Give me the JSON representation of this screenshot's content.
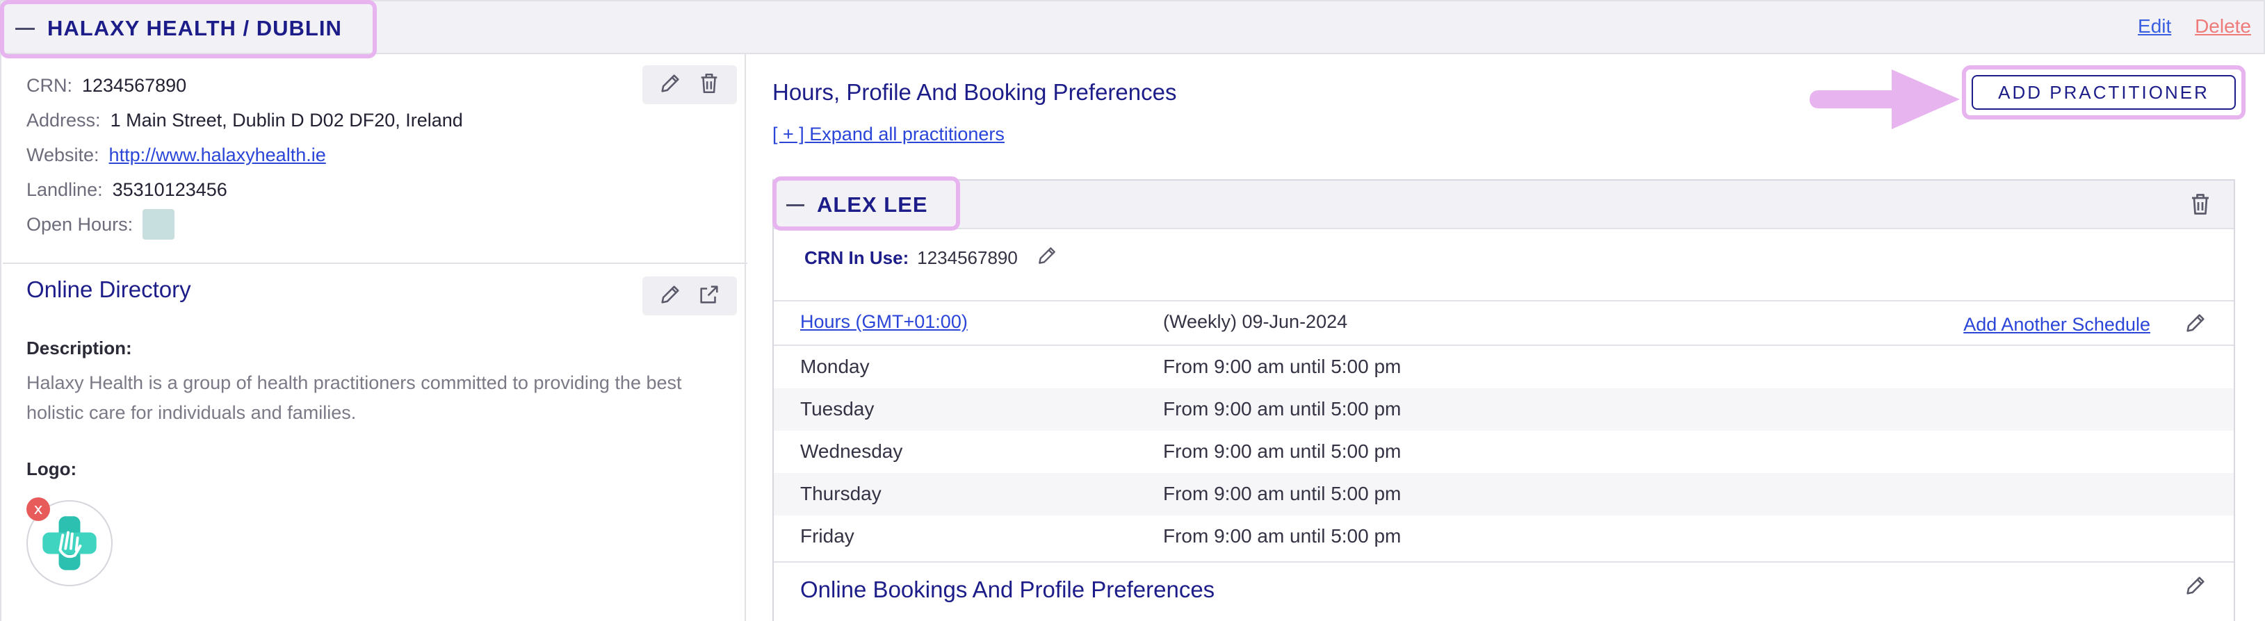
{
  "header": {
    "clinic_title": "HALAXY HEALTH / DUBLIN",
    "edit_label": "Edit",
    "delete_label": "Delete"
  },
  "clinic_info": {
    "crn_label": "CRN:",
    "crn_value": "1234567890",
    "address_label": "Address:",
    "address_value": "1 Main Street, Dublin D D02 DF20, Ireland",
    "website_label": "Website:",
    "website_value": "http://www.halaxyhealth.ie",
    "landline_label": "Landline:",
    "landline_value": "35310123456",
    "open_hours_label": "Open Hours:"
  },
  "online_directory": {
    "title": "Online Directory",
    "description_label": "Description:",
    "description_text": "Halaxy Health is a group of health practitioners committed to providing the best holistic care for individuals and families.",
    "logo_label": "Logo:",
    "logo_remove": "x"
  },
  "preferences": {
    "title": "Hours, Profile And Booking Preferences",
    "expand_label": "[ + ] Expand all practitioners",
    "add_button": "ADD PRACTITIONER"
  },
  "practitioner": {
    "name": "ALEX LEE",
    "crn_label": "CRN In Use:",
    "crn_value": "1234567890",
    "hours_label": "Hours (GMT+01:00)",
    "schedule_label": "(Weekly) 09-Jun-2024",
    "add_schedule": "Add Another Schedule",
    "days": [
      {
        "day": "Monday",
        "time": "From 9:00 am until 5:00 pm"
      },
      {
        "day": "Tuesday",
        "time": "From 9:00 am until 5:00 pm"
      },
      {
        "day": "Wednesday",
        "time": "From 9:00 am until 5:00 pm"
      },
      {
        "day": "Thursday",
        "time": "From 9:00 am until 5:00 pm"
      },
      {
        "day": "Friday",
        "time": "From 9:00 am until 5:00 pm"
      }
    ],
    "online_bookings_title": "Online Bookings And Profile Preferences"
  },
  "colors": {
    "accent": "#1d1d8a",
    "link": "#2a45d8",
    "highlight": "#e8b4f0",
    "danger": "#ef7a7a"
  }
}
